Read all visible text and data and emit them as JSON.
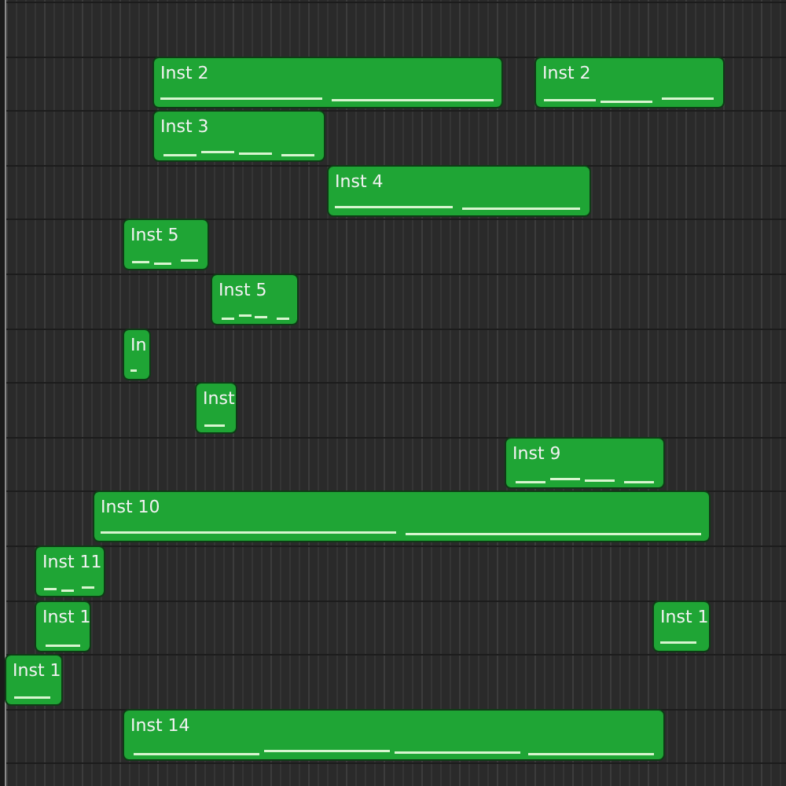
{
  "regions": [
    {
      "label": "Inst 2"
    },
    {
      "label": "Inst 2"
    },
    {
      "label": "Inst 3"
    },
    {
      "label": "Inst 4"
    },
    {
      "label": "Inst 5"
    },
    {
      "label": "Inst 5"
    },
    {
      "label": "In"
    },
    {
      "label": "Inst"
    },
    {
      "label": "Inst 9"
    },
    {
      "label": "Inst 10"
    },
    {
      "label": "Inst 11"
    },
    {
      "label": "Inst 1"
    },
    {
      "label": "Inst 1"
    },
    {
      "label": "Inst 1"
    },
    {
      "label": "Inst 14"
    }
  ]
}
